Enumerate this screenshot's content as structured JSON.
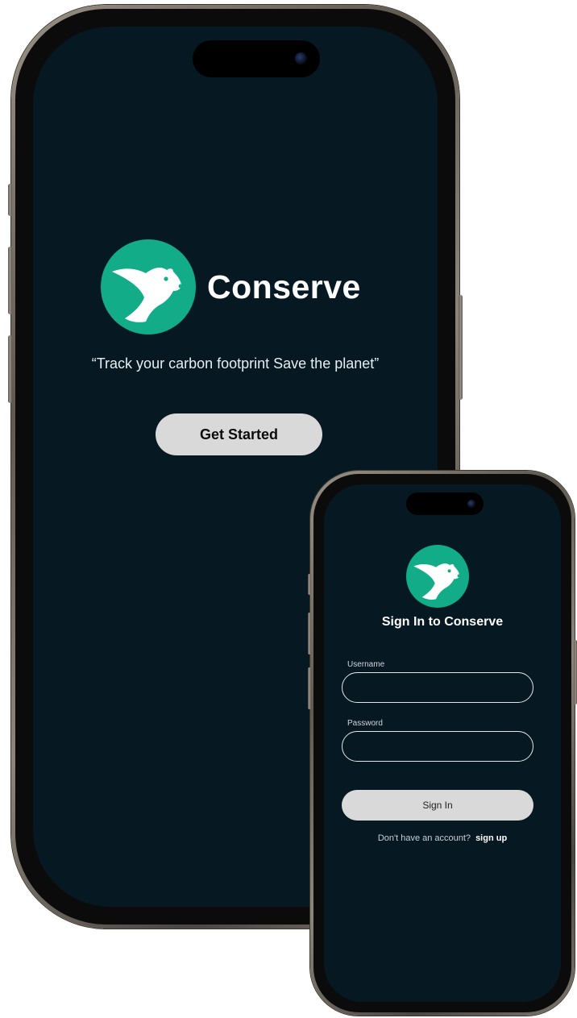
{
  "colors": {
    "screen_bg": "#061822",
    "accent": "#12ad88",
    "button_bg": "#d9d9d9",
    "text": "#ffffff"
  },
  "welcome_screen": {
    "brand_name": "Conserve",
    "tagline": "“Track your carbon footprint Save the planet”",
    "get_started_label": "Get Started",
    "logo_icon": "bear-logo-icon"
  },
  "signin_screen": {
    "title": "Sign In to Conserve",
    "username_label": "Username",
    "username_value": "",
    "password_label": "Password",
    "password_value": "",
    "signin_label": "Sign In",
    "signup_prompt": "Don't have an account?",
    "signup_link": "sign up",
    "logo_icon": "bear-logo-icon"
  }
}
